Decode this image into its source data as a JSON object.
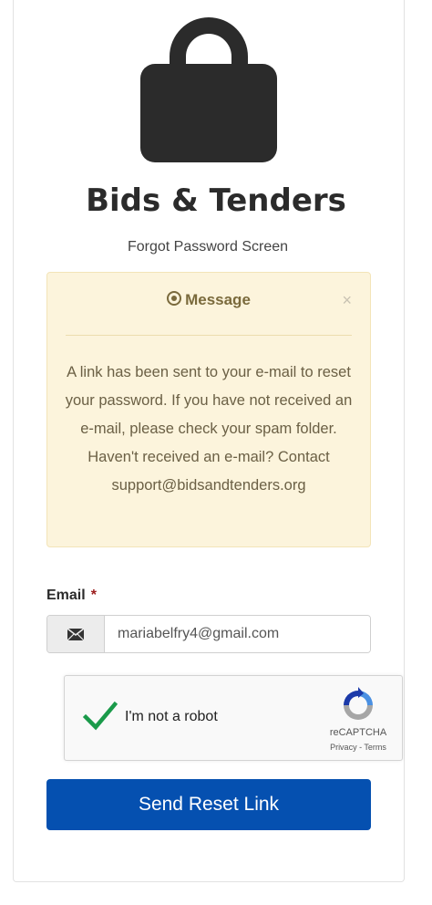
{
  "brand": {
    "title": "Bids & Tenders",
    "subtitle": "Forgot Password Screen",
    "lock_icon": "lock-icon"
  },
  "alert": {
    "title": "Message",
    "icon": "target-circle-icon",
    "close_label": "×",
    "body": "A link has been sent to your e-mail to reset your password. If you have not received an e-mail, please check your spam folder. Haven't received an e-mail? Contact support@bidsandtenders.org"
  },
  "form": {
    "email_label": "Email",
    "required_marker": "*",
    "email_icon": "envelope-icon",
    "email_value": "mariabelfry4@gmail.com"
  },
  "recaptcha": {
    "label": "I'm not a robot",
    "brand": "reCAPTCHA",
    "privacy": "Privacy",
    "separator": " - ",
    "terms": "Terms",
    "checked": true
  },
  "actions": {
    "send_reset_label": "Send Reset Link"
  },
  "colors": {
    "primary_button": "#0550b0",
    "alert_bg": "#fcf4dc",
    "lock": "#2b2b2b",
    "check": "#1a9a4a"
  }
}
